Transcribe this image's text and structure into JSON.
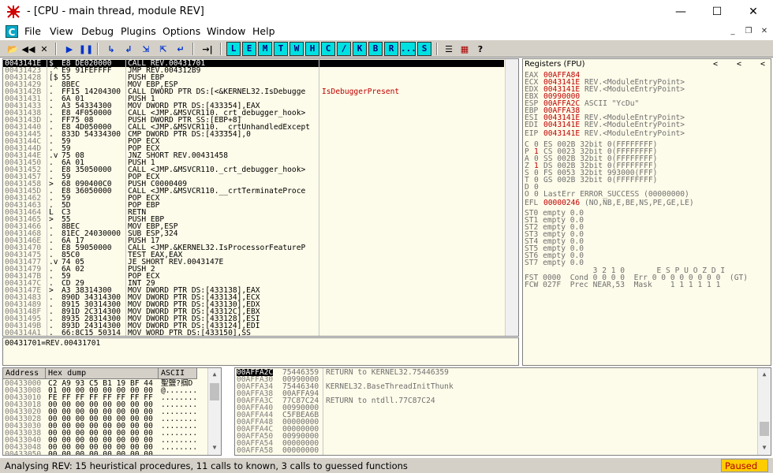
{
  "window": {
    "title": "- [CPU - main thread, module REV]",
    "min": "—",
    "max": "☐",
    "close": "✕"
  },
  "menu": [
    "File",
    "View",
    "Debug",
    "Plugins",
    "Options",
    "Window",
    "Help"
  ],
  "menu_icon": "C",
  "toolbar_letters": [
    "L",
    "E",
    "M",
    "T",
    "W",
    "H",
    "C",
    "/",
    "K",
    "B",
    "R",
    "...",
    "S"
  ],
  "toolbar_icons": [
    "◀◀",
    "✕",
    "▶",
    "❚❚",
    "↳",
    "↲",
    "⇲",
    "⇱",
    "↵",
    "→|"
  ],
  "toolbar_extra": [
    "☰",
    "▦",
    "?"
  ],
  "disasm": [
    {
      "addr": "0043141E",
      "mark": "$",
      "hex": "E8 DE020000",
      "ins": "CALL REV.00431701",
      "sel": true
    },
    {
      "addr": "00431423",
      "mark": ".^",
      "hex": "E9 91FEFFFF",
      "ins": "JMP REV.004312B9"
    },
    {
      "addr": "00431428",
      "mark": "[$",
      "hex": "55",
      "ins": "PUSH EBP"
    },
    {
      "addr": "00431429",
      "mark": ".",
      "hex": "8BEC",
      "ins": "MOV EBP,ESP"
    },
    {
      "addr": "0043142B",
      "mark": ".",
      "hex": "FF15 14204300",
      "ins": "CALL DWORD PTR DS:[<&KERNEL32.IsDebugge",
      "cmt": "IsDebuggerPresent"
    },
    {
      "addr": "00431431",
      "mark": ".",
      "hex": "6A 01",
      "ins": "PUSH 1"
    },
    {
      "addr": "00431433",
      "mark": ".",
      "hex": "A3 54334300",
      "ins": "MOV DWORD PTR DS:[433354],EAX"
    },
    {
      "addr": "00431438",
      "mark": ".",
      "hex": "E8 4F050000",
      "ins": "CALL <JMP.&MSVCR110._crt_debugger_hook>"
    },
    {
      "addr": "0043143D",
      "mark": ".",
      "hex": "FF75 08",
      "ins": "PUSH DWORD PTR SS:[EBP+8]"
    },
    {
      "addr": "00431440",
      "mark": ".",
      "hex": "E8 4D050000",
      "ins": "CALL <JMP.&MSVCR110.__crtUnhandledExcept"
    },
    {
      "addr": "00431445",
      "mark": ".",
      "hex": "833D 54334300",
      "ins": "CMP DWORD PTR DS:[433354],0"
    },
    {
      "addr": "0043144C",
      "mark": ".",
      "hex": "59",
      "ins": "POP ECX"
    },
    {
      "addr": "0043144D",
      "mark": ".",
      "hex": "59",
      "ins": "POP ECX"
    },
    {
      "addr": "0043144E",
      "mark": ".v",
      "hex": "75 08",
      "ins": "JNZ SHORT REV.00431458"
    },
    {
      "addr": "00431450",
      "mark": ".",
      "hex": "6A 01",
      "ins": "PUSH 1"
    },
    {
      "addr": "00431452",
      "mark": ".",
      "hex": "E8 35050000",
      "ins": "CALL <JMP.&MSVCR110._crt_debugger_hook>"
    },
    {
      "addr": "00431457",
      "mark": ".",
      "hex": "59",
      "ins": "POP ECX"
    },
    {
      "addr": "00431458",
      "mark": ">",
      "hex": "68 090400C0",
      "ins": "PUSH C0000409"
    },
    {
      "addr": "0043145D",
      "mark": ".",
      "hex": "E8 36050000",
      "ins": "CALL <JMP.&MSVCR110.__crtTerminateProce"
    },
    {
      "addr": "00431462",
      "mark": ".",
      "hex": "59",
      "ins": "POP ECX"
    },
    {
      "addr": "00431463",
      "mark": ".",
      "hex": "5D",
      "ins": "POP EBP"
    },
    {
      "addr": "00431464",
      "mark": "L",
      "hex": "C3",
      "ins": "RETN"
    },
    {
      "addr": "00431465",
      "mark": ">",
      "hex": "55",
      "ins": "PUSH EBP"
    },
    {
      "addr": "00431466",
      "mark": ".",
      "hex": "8BEC",
      "ins": "MOV EBP,ESP"
    },
    {
      "addr": "00431468",
      "mark": ".",
      "hex": "81EC 24030000",
      "ins": "SUB ESP,324"
    },
    {
      "addr": "0043146E",
      "mark": ".",
      "hex": "6A 17",
      "ins": "PUSH 17"
    },
    {
      "addr": "00431470",
      "mark": ".",
      "hex": "E8 59050000",
      "ins": "CALL <JMP.&KERNEL32.IsProcessorFeatureP"
    },
    {
      "addr": "00431475",
      "mark": ".",
      "hex": "85C0",
      "ins": "TEST EAX,EAX"
    },
    {
      "addr": "00431477",
      "mark": ".v",
      "hex": "74 05",
      "ins": "JE SHORT REV.0043147E"
    },
    {
      "addr": "00431479",
      "mark": ".",
      "hex": "6A 02",
      "ins": "PUSH 2"
    },
    {
      "addr": "0043147B",
      "mark": ".",
      "hex": "59",
      "ins": "POP ECX"
    },
    {
      "addr": "0043147C",
      "mark": ".",
      "hex": "CD 29",
      "ins": "INT 29"
    },
    {
      "addr": "0043147E",
      "mark": ">",
      "hex": "A3 38314300",
      "ins": "MOV DWORD PTR DS:[433138],EAX"
    },
    {
      "addr": "00431483",
      "mark": ".",
      "hex": "890D 34314300",
      "ins": "MOV DWORD PTR DS:[433134],ECX"
    },
    {
      "addr": "00431489",
      "mark": ".",
      "hex": "8915 30314300",
      "ins": "MOV DWORD PTR DS:[433130],EDX"
    },
    {
      "addr": "0043148F",
      "mark": ".",
      "hex": "891D 2C314300",
      "ins": "MOV DWORD PTR DS:[43312C],EBX"
    },
    {
      "addr": "00431495",
      "mark": ".",
      "hex": "8935 28314300",
      "ins": "MOV DWORD PTR DS:[433128],ESI"
    },
    {
      "addr": "0043149B",
      "mark": ".",
      "hex": "893D 24314300",
      "ins": "MOV DWORD PTR DS:[433124],EDI"
    },
    {
      "addr": "004314A1",
      "mark": ".",
      "hex": "66:8C15 50314",
      "ins": "MOV WORD PTR DS:[433150],SS"
    }
  ],
  "info_line": "00431701=REV.00431701",
  "registers": {
    "header": "Registers (FPU)",
    "nav": [
      "<",
      "<",
      "<"
    ],
    "gp": [
      {
        "name": "EAX",
        "val": "00AFFA84",
        "cmt": ""
      },
      {
        "name": "ECX",
        "val": "0043141E",
        "cmt": "REV.<ModuleEntryPoint>"
      },
      {
        "name": "EDX",
        "val": "0043141E",
        "cmt": "REV.<ModuleEntryPoint>"
      },
      {
        "name": "EBX",
        "val": "00990000",
        "cmt": ""
      },
      {
        "name": "ESP",
        "val": "00AFFA2C",
        "cmt": "ASCII \"YcDu\""
      },
      {
        "name": "EBP",
        "val": "00AFFA38",
        "cmt": ""
      },
      {
        "name": "ESI",
        "val": "0043141E",
        "cmt": "REV.<ModuleEntryPoint>"
      },
      {
        "name": "EDI",
        "val": "0043141E",
        "cmt": "REV.<ModuleEntryPoint>"
      }
    ],
    "eip": {
      "name": "EIP",
      "val": "0043141E",
      "cmt": "REV.<ModuleEntryPoint>"
    },
    "flags": [
      {
        "f": "C",
        "v": "0",
        "seg": "ES 002B 32bit 0(FFFFFFFF)"
      },
      {
        "f": "P",
        "v": "1",
        "seg": "CS 0023 32bit 0(FFFFFFFF)"
      },
      {
        "f": "A",
        "v": "0",
        "seg": "SS 002B 32bit 0(FFFFFFFF)"
      },
      {
        "f": "Z",
        "v": "1",
        "seg": "DS 002B 32bit 0(FFFFFFFF)"
      },
      {
        "f": "S",
        "v": "0",
        "seg": "FS 0053 32bit 993000(FFF)"
      },
      {
        "f": "T",
        "v": "0",
        "seg": "GS 002B 32bit 0(FFFFFFFF)"
      },
      {
        "f": "D",
        "v": "0",
        "seg": ""
      },
      {
        "f": "O",
        "v": "0",
        "seg": "LastErr ERROR_SUCCESS (00000000)"
      }
    ],
    "efl": {
      "name": "EFL",
      "val": "00000246",
      "cmt": "(NO,NB,E,BE,NS,PE,GE,LE)"
    },
    "st": [
      "ST0 empty 0.0",
      "ST1 empty 0.0",
      "ST2 empty 0.0",
      "ST3 empty 0.0",
      "ST4 empty 0.0",
      "ST5 empty 0.0",
      "ST6 empty 0.0",
      "ST7 empty 0.0"
    ],
    "fpu_hdr": "               3 2 1 0       E S P U O Z D I",
    "fst": "FST 0000  Cond 0 0 0 0  Err 0 0 0 0 0 0 0 0  (GT)",
    "fcw": "FCW 027F  Prec NEAR,53  Mask    1 1 1 1 1 1"
  },
  "dump": {
    "headers": [
      "Address",
      "Hex dump",
      "ASCII"
    ],
    "rows": [
      {
        "a": "00433000",
        "h": "C2 A9 93 C5 B1 19 BF 44",
        "s": "聖鹽?掴D"
      },
      {
        "a": "00433008",
        "h": "01 00 00 00 00 00 00 00",
        "s": "@......."
      },
      {
        "a": "00433010",
        "h": "FE FF FF FF FF FF FF FF",
        "s": "........"
      },
      {
        "a": "00433018",
        "h": "00 00 00 00 00 00 00 00",
        "s": "........"
      },
      {
        "a": "00433020",
        "h": "00 00 00 00 00 00 00 00",
        "s": "........"
      },
      {
        "a": "00433028",
        "h": "00 00 00 00 00 00 00 00",
        "s": "........"
      },
      {
        "a": "00433030",
        "h": "00 00 00 00 00 00 00 00",
        "s": "........"
      },
      {
        "a": "00433038",
        "h": "00 00 00 00 00 00 00 00",
        "s": "........"
      },
      {
        "a": "00433040",
        "h": "00 00 00 00 00 00 00 00",
        "s": "........"
      },
      {
        "a": "00433048",
        "h": "00 00 00 00 00 00 00 00",
        "s": "........"
      },
      {
        "a": "00433050",
        "h": "00 00 00 00 00 00 00 00",
        "s": "........"
      }
    ]
  },
  "stack": [
    {
      "a": "00AFFA2C",
      "v": "75446359",
      "c": "RETURN to KERNEL32.75446359",
      "sel": true
    },
    {
      "a": "00AFFA30",
      "v": "00990000",
      "c": ""
    },
    {
      "a": "00AFFA34",
      "v": "75446340",
      "c": "KERNEL32.BaseThreadInitThunk"
    },
    {
      "a": "00AFFA38",
      "v": "00AFFA94",
      "c": ""
    },
    {
      "a": "00AFFA3C",
      "v": "77C87C24",
      "c": "RETURN to ntdll.77C87C24"
    },
    {
      "a": "00AFFA40",
      "v": "00990000",
      "c": ""
    },
    {
      "a": "00AFFA44",
      "v": "C5FBEA6B",
      "c": ""
    },
    {
      "a": "00AFFA48",
      "v": "00000000",
      "c": ""
    },
    {
      "a": "00AFFA4C",
      "v": "00000000",
      "c": ""
    },
    {
      "a": "00AFFA50",
      "v": "00990000",
      "c": ""
    },
    {
      "a": "00AFFA54",
      "v": "00000000",
      "c": ""
    },
    {
      "a": "00AFFA58",
      "v": "00000000",
      "c": ""
    }
  ],
  "status": {
    "text": "Analysing REV: 15 heuristical procedures, 11 calls to known, 3 calls to guessed functions",
    "state": "Paused"
  },
  "colors": {
    "accent_red": "#c00000",
    "paused_bg": "#ffcc00",
    "pane_bg": "#fdfbe9"
  }
}
